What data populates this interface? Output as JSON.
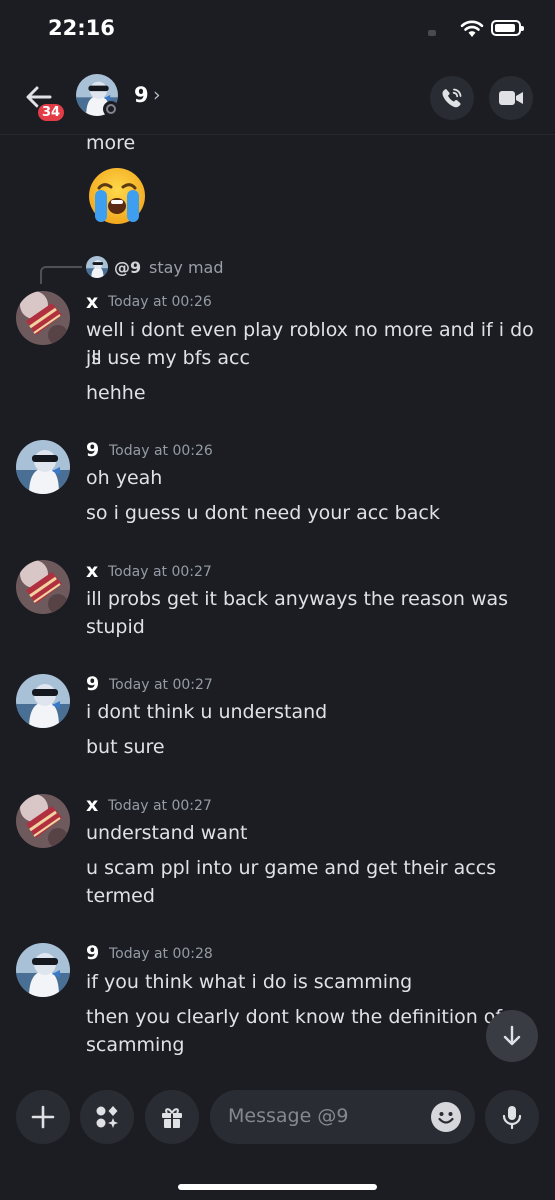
{
  "status_bar": {
    "time": "22:16"
  },
  "header": {
    "unread_badge": "34",
    "name": "9",
    "chevron": "›"
  },
  "messages": {
    "top_continuation": "more",
    "reply": {
      "mention": "@9",
      "text": "stay mad"
    },
    "groups": [
      {
        "author": "x",
        "timestamp": "Today at 00:26",
        "lines": [
          "well i dont even play roblox no more and if i do ill",
          "js use my bfs acc",
          "hehhe"
        ]
      },
      {
        "author": "9",
        "timestamp": "Today at 00:26",
        "lines": [
          "oh yeah",
          "so i guess u dont need your acc back"
        ]
      },
      {
        "author": "x",
        "timestamp": "Today at 00:27",
        "lines": [
          "ill probs get it back anyways the reason was",
          "stupid"
        ]
      },
      {
        "author": "9",
        "timestamp": "Today at 00:27",
        "lines": [
          "i dont think u understand",
          "but sure"
        ]
      },
      {
        "author": "x",
        "timestamp": "Today at 00:27",
        "lines": [
          "understand want",
          "u scam ppl into ur game and get their accs",
          "termed"
        ]
      },
      {
        "author": "9",
        "timestamp": "Today at 00:28",
        "lines": [
          "if you think what i do is scamming",
          "then you clearly dont know the definition of",
          "scamming"
        ]
      }
    ]
  },
  "composer": {
    "placeholder": "Message @9"
  },
  "colors": {
    "background": "#1c1d23",
    "button": "#2a2c33",
    "badge": "#e23c46"
  },
  "icons": [
    "back-arrow-icon",
    "phone-icon",
    "video-icon",
    "plus-icon",
    "apps-icon",
    "gift-icon",
    "emoji-icon",
    "microphone-icon",
    "arrow-down-icon"
  ]
}
